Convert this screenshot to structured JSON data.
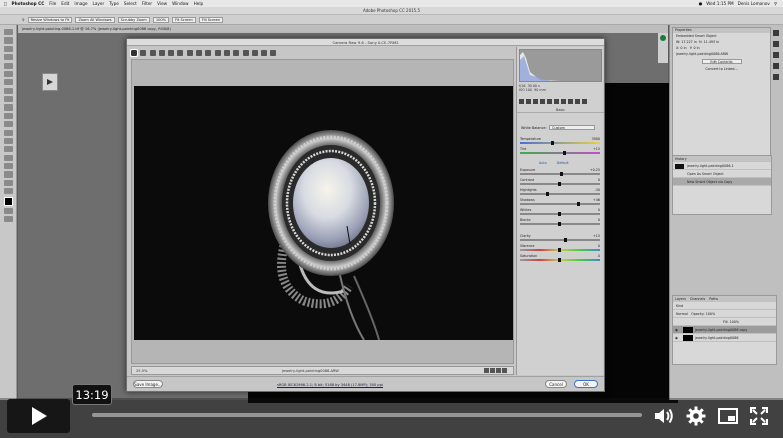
{
  "menubar": {
    "app": "Photoshop CC",
    "items": [
      "File",
      "Edit",
      "Image",
      "Layer",
      "Type",
      "Select",
      "Filter",
      "View",
      "Window",
      "Help"
    ],
    "clock": "Wed 1:15 PM",
    "user": "Denis Lomonov"
  },
  "ps": {
    "window_title": "Adobe Photoshop CC 2015.5",
    "options": [
      "Resize Windows to Fit",
      "Zoom All Windows",
      "Scrubby Zoom",
      "100%",
      "Fit Screen",
      "Fill Screen"
    ],
    "doc_tab": "jewelry-light-painting-0086-1.tif @ 16.7% (jewelry-light-painting0086 copy, RGB/8)"
  },
  "camera_raw": {
    "title": "Camera Raw 9.6 - Sony ILCE-7RM2",
    "zoom": "25.5%",
    "filename": "jewelry-light-painting0086.ARW",
    "workflow": "sRGB IEC61966-2.1; 8 bit; 5168 by 3448 (17.8MP); 300 ppi",
    "save_label": "Save Image...",
    "cancel_label": "Cancel",
    "ok_label": "OK",
    "readout": {
      "f": "f/16",
      "shutter": "30.00 s",
      "iso": "ISO 100",
      "lens": "90 mm"
    },
    "panel_title": "Basic",
    "white_balance_label": "White Balance:",
    "white_balance_value": "Custom",
    "auto_label": "Auto",
    "default_label": "Default",
    "sliders": [
      {
        "label": "Temperature",
        "value": "3900",
        "pos": 0.42
      },
      {
        "label": "Tint",
        "value": "+15",
        "pos": 0.56
      },
      {
        "label": "Exposure",
        "value": "+0.25",
        "pos": 0.52
      },
      {
        "label": "Contrast",
        "value": "0",
        "pos": 0.5
      },
      {
        "label": "Highlights",
        "value": "-30",
        "pos": 0.35
      },
      {
        "label": "Shadows",
        "value": "+46",
        "pos": 0.73
      },
      {
        "label": "Whites",
        "value": "0",
        "pos": 0.5
      },
      {
        "label": "Blacks",
        "value": "0",
        "pos": 0.5
      },
      {
        "label": "Clarity",
        "value": "+15",
        "pos": 0.57
      },
      {
        "label": "Vibrance",
        "value": "0",
        "pos": 0.5
      },
      {
        "label": "Saturation",
        "value": "0",
        "pos": 0.5
      }
    ]
  },
  "properties": {
    "tab": "Properties",
    "title": "Embedded Smart Object",
    "w": "W: 17.227 in",
    "h": "H: 11.493 in",
    "x": "X: 0 in",
    "y": "Y: 0 in",
    "file": "jewelry-light-painting0086.ARW",
    "edit_contents": "Edit Contents",
    "convert_label": "Convert to Linked..."
  },
  "history": {
    "tab": "History",
    "snapshot": "jewelry-light-painting0086-1",
    "items": [
      "Open As Smart Object",
      "New Smart Object via Copy"
    ]
  },
  "layers": {
    "tabs": [
      "Layers",
      "Channels",
      "Paths"
    ],
    "kind": "Kind",
    "blend": "Normal",
    "opacity": "Opacity: 100%",
    "fill": "Fill: 100%",
    "rows": [
      "jewelry-light-painting0086 copy",
      "jewelry-light-painting0086"
    ]
  },
  "player": {
    "time": "13:19"
  }
}
